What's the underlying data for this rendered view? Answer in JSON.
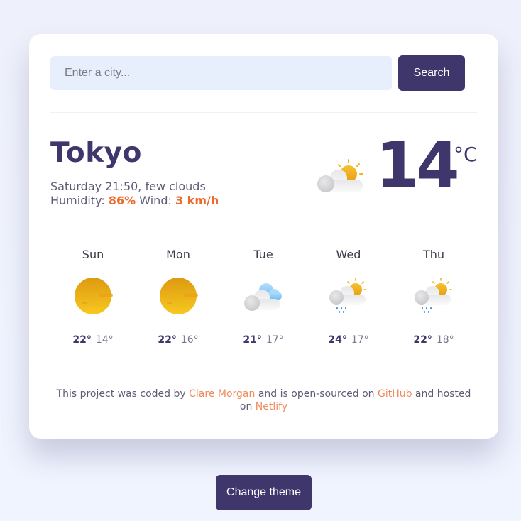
{
  "search": {
    "placeholder": "Enter a city...",
    "value": "",
    "button_label": "Search"
  },
  "current": {
    "city": "Tokyo",
    "datetime": "Saturday 21:50",
    "description": "few clouds",
    "humidity_label": "Humidity:",
    "humidity": "86%",
    "wind_label": "Wind:",
    "wind": "3 km/h",
    "temperature": "14",
    "unit": "°C",
    "icon": "few-clouds-day-icon"
  },
  "forecast": [
    {
      "day": "Sun",
      "icon": "clear-sky-icon",
      "max": "22°",
      "min": "14°"
    },
    {
      "day": "Mon",
      "icon": "clear-sky-icon",
      "max": "22°",
      "min": "16°"
    },
    {
      "day": "Tue",
      "icon": "broken-clouds-icon",
      "max": "21°",
      "min": "17°"
    },
    {
      "day": "Wed",
      "icon": "rain-day-icon",
      "max": "24°",
      "min": "17°"
    },
    {
      "day": "Thu",
      "icon": "rain-day-icon",
      "max": "22°",
      "min": "18°"
    }
  ],
  "footer": {
    "text1": "This project was coded by ",
    "author": "Clare Morgan",
    "text2": " and is open-sourced on ",
    "github": "GitHub",
    "text3": " and hosted on ",
    "netlify": "Netlify"
  },
  "theme_button_label": "Change theme",
  "colors": {
    "primary": "#3f366c",
    "accent": "#ee6a2a",
    "link": "#ef8a5a",
    "input_bg": "#e7effc"
  }
}
